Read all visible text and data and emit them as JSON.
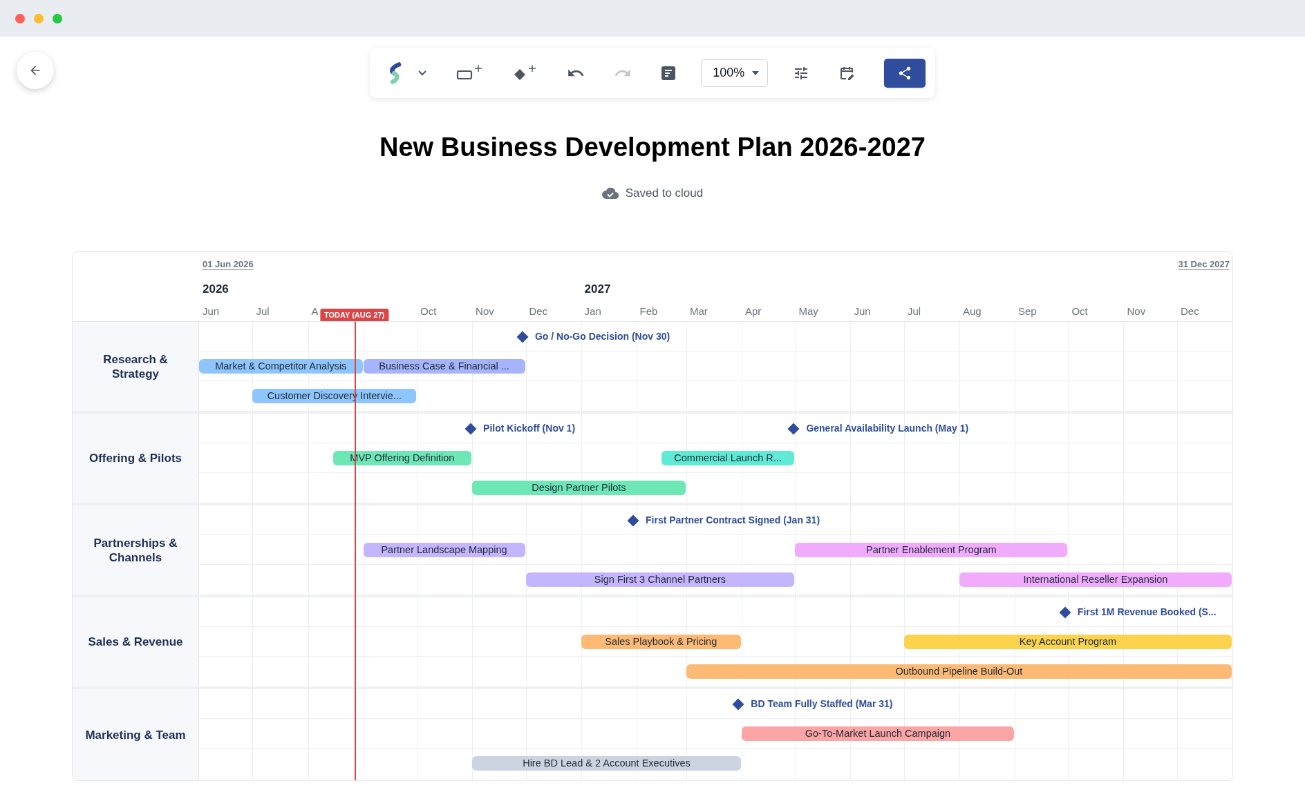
{
  "toolbar": {
    "items": [
      {
        "kind": "logo"
      },
      {
        "kind": "menu"
      },
      {
        "kind": "add-task"
      },
      {
        "kind": "add-milestone"
      },
      {
        "kind": "undo",
        "disabled": false
      },
      {
        "kind": "redo",
        "disabled": true
      },
      {
        "kind": "notes"
      },
      {
        "kind": "zoom",
        "value": "100%"
      },
      {
        "kind": "settings"
      },
      {
        "kind": "calendar"
      },
      {
        "kind": "share"
      }
    ]
  },
  "title": "New Business Development Plan 2026-2027",
  "save_status": "Saved to cloud",
  "timeline": {
    "start_label": "01 Jun 2026",
    "end_label": "31 Dec 2027",
    "years": [
      "2026",
      "2027"
    ],
    "months": [
      {
        "label": "Jun"
      },
      {
        "label": "Jul"
      },
      {
        "label": "A"
      },
      {
        "label": "Oct"
      },
      {
        "label": "Nov"
      },
      {
        "label": "Dec"
      },
      {
        "label": "Jan"
      },
      {
        "label": "Feb"
      },
      {
        "label": "Mar"
      },
      {
        "label": "Apr"
      },
      {
        "label": "May"
      },
      {
        "label": "Jun"
      },
      {
        "label": "Jul"
      },
      {
        "label": "Aug"
      },
      {
        "label": "Sep"
      },
      {
        "label": "Oct"
      },
      {
        "label": "Nov"
      },
      {
        "label": "Dec"
      }
    ],
    "today": {
      "label": "TODAY (AUG 27)"
    }
  },
  "groups": [
    {
      "name": "Research & Strategy",
      "lanes": [
        [
          {
            "kind": "milestone",
            "label": "Go / No-Go Decision (Nov 30)"
          }
        ],
        [
          {
            "kind": "task",
            "label": "Market & Competitor Analysis",
            "color": "#8ec5fc"
          },
          {
            "kind": "task",
            "label": "Business Case & Financial ...",
            "color": "#a5b4fc"
          }
        ],
        [
          {
            "kind": "task",
            "label": "Customer Discovery Intervie...",
            "color": "#8ec5fc"
          }
        ]
      ]
    },
    {
      "name": "Offering & Pilots",
      "lanes": [
        [
          {
            "kind": "milestone",
            "label": "Pilot Kickoff (Nov 1)"
          },
          {
            "kind": "milestone",
            "label": "General Availability Launch (May 1)"
          }
        ],
        [
          {
            "kind": "task",
            "label": "MVP Offering Definition",
            "color": "#6ee7b7"
          },
          {
            "kind": "task",
            "label": "Commercial Launch R...",
            "color": "#5eead4"
          }
        ],
        [
          {
            "kind": "task",
            "label": "Design Partner Pilots",
            "color": "#6ee7b7"
          }
        ]
      ]
    },
    {
      "name": "Partnerships & Channels",
      "lanes": [
        [
          {
            "kind": "milestone",
            "label": "First Partner Contract Signed (Jan 31)"
          }
        ],
        [
          {
            "kind": "task",
            "label": "Partner Landscape Mapping",
            "color": "#c4b5fd"
          },
          {
            "kind": "task",
            "label": "Partner Enablement Program",
            "color": "#f0abfc"
          }
        ],
        [
          {
            "kind": "task",
            "label": "Sign First 3 Channel Partners",
            "color": "#c4b5fd"
          },
          {
            "kind": "task",
            "label": "International Reseller Expansion",
            "color": "#f0abfc"
          }
        ]
      ]
    },
    {
      "name": "Sales & Revenue",
      "lanes": [
        [
          {
            "kind": "milestone",
            "label": "First 1M Revenue Booked (S..."
          }
        ],
        [
          {
            "kind": "task",
            "label": "Sales Playbook & Pricing",
            "color": "#fdba74"
          },
          {
            "kind": "task",
            "label": "Key Account Program",
            "color": "#fcd34d"
          }
        ],
        [
          {
            "kind": "task",
            "label": "Outbound Pipeline Build-Out",
            "color": "#fdba74"
          }
        ]
      ]
    },
    {
      "name": "Marketing & Team",
      "lanes": [
        [
          {
            "kind": "milestone",
            "label": "BD Team Fully Staffed (Mar 31)"
          }
        ],
        [
          {
            "kind": "task",
            "label": "Go-To-Market Launch Campaign",
            "color": "#fca5a5"
          }
        ],
        [
          {
            "kind": "task",
            "label": "Hire BD Lead & 2 Account Executives",
            "color": "#cbd5e1"
          }
        ]
      ]
    }
  ]
}
